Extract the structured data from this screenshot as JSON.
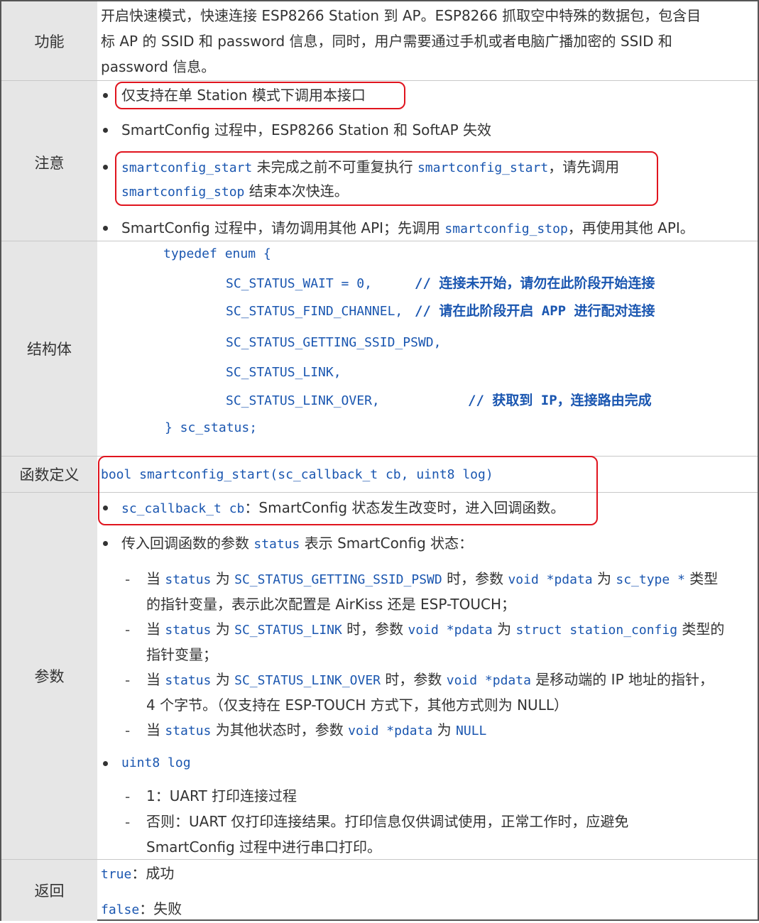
{
  "labels": {
    "function": "功能",
    "notes": "注意",
    "struct": "结构体",
    "definition": "函数定义",
    "params": "参数",
    "return": "返回"
  },
  "function": {
    "line1": "开启快速模式，快速连接 ESP8266 Station 到 AP。ESP8266 抓取空中特殊的数据包，包含目",
    "line2": "标 AP 的 SSID 和 password 信息，同时，用户需要通过手机或者电脑广播加密的 SSID 和",
    "line3": "password 信息。"
  },
  "notes": {
    "n1": "仅支持在单 Station 模式下调用本接口",
    "n2": "SmartConfig 过程中，ESP8266 Station 和 SoftAP 失效",
    "n3_code1": "smartconfig_start",
    "n3_text1": " 未完成之前不可重复执行 ",
    "n3_code2": "smartconfig_start",
    "n3_text2": "，请先调用",
    "n3_code3": "smartconfig_stop",
    "n3_text3": " 结束本次快连。",
    "n4_text1": "SmartConfig 过程中，请勿调用其他 API；先调用 ",
    "n4_code": "smartconfig_stop",
    "n4_text2": "，再使用其他 API。"
  },
  "struct": {
    "head": "typedef enum  {",
    "e1": "SC_STATUS_WAIT = 0,",
    "c1": "// 连接未开始，请勿在此阶段开始连接",
    "e2": "SC_STATUS_FIND_CHANNEL,",
    "c2": "// 请在此阶段开启 APP 进行配对连接",
    "e3": "SC_STATUS_GETTING_SSID_PSWD,",
    "e4": "SC_STATUS_LINK,",
    "e5": "SC_STATUS_LINK_OVER,",
    "c5": "// 获取到 IP，连接路由完成",
    "tail": "} sc_status;"
  },
  "definition": "bool smartconfig_start(sc_callback_t cb, uint8 log)",
  "params": {
    "p1_code": "sc_callback_t cb",
    "p1_text": "：SmartConfig 状态发生改变时，进入回调函数。",
    "p2_text1": "传入回调函数的参数 ",
    "p2_code": "status",
    "p2_text2": " 表示 SmartConfig 状态：",
    "s1": {
      "a": "当 ",
      "b": "status",
      "c": " 为 ",
      "d": "SC_STATUS_GETTING_SSID_PSWD",
      "e": " 时，参数 ",
      "f": "void *pdata",
      "g": " 为 ",
      "h": "sc_type *",
      "i": " 类型",
      "line2": "的指针变量，表示此次配置是 AirKiss 还是 ESP-TOUCH；"
    },
    "s2": {
      "a": "当 ",
      "b": "status",
      "c": " 为 ",
      "d": "SC_STATUS_LINK",
      "e": " 时，参数 ",
      "f": "void *pdata",
      "g": " 为 ",
      "h": "struct station_config",
      "i": " 类型的",
      "line2": "指针变量；"
    },
    "s3": {
      "a": "当 ",
      "b": "status",
      "c": " 为 ",
      "d": "SC_STATUS_LINK_OVER",
      "e": " 时，参数 ",
      "f": "void *pdata",
      "g": " 是移动端的 IP 地址的指针，",
      "line2": "4 个字节。（仅支持在 ESP-TOUCH 方式下，其他方式则为 NULL）"
    },
    "s4": {
      "a": "当 ",
      "b": "status",
      "c": " 为其他状态时，参数 ",
      "d": "void *pdata",
      "e": " 为 ",
      "f": "NULL"
    },
    "p3_code": "uint8 log",
    "l1": "1：UART 打印连接过程",
    "l2_line1": "否则：UART 仅打印连接结果。打印信息仅供调试使用，正常工作时，应避免",
    "l2_line2": "SmartConfig 过程中进行串口打印。"
  },
  "return": {
    "true_code": "true",
    "true_text": "：成功",
    "false_code": "false",
    "false_text": "：失败"
  }
}
